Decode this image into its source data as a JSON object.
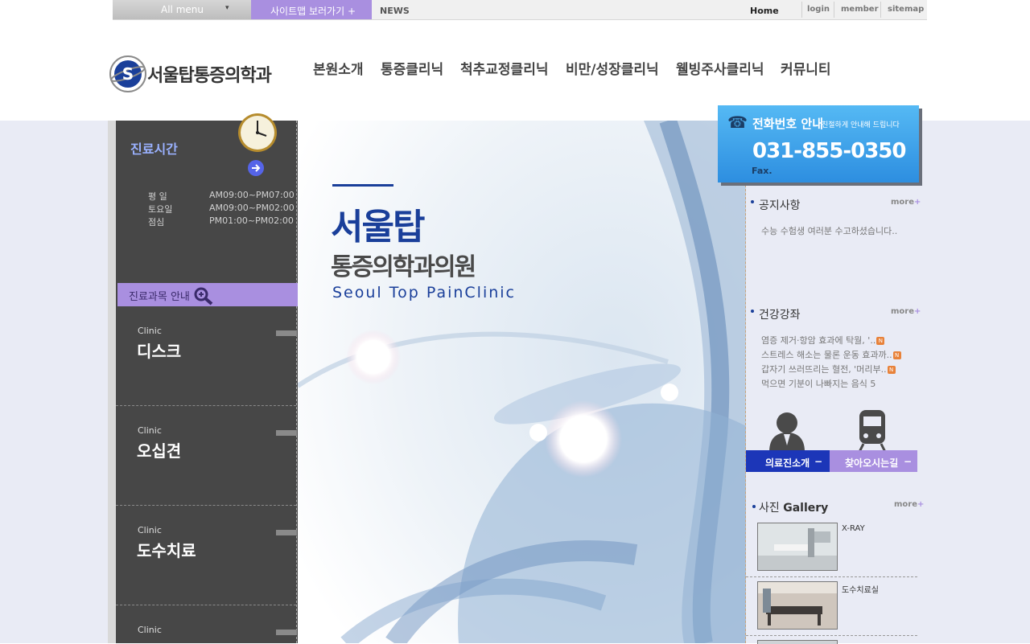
{
  "topbar": {
    "all_menu": "All menu",
    "sitemap": "사이트맵 보러가기 +",
    "news": "NEWS",
    "home": "Home",
    "login": "login",
    "member": "member",
    "sitemap_link": "sitemap"
  },
  "logo": {
    "text": "서울탑통증의학과",
    "emblem_letter": "S"
  },
  "nav": [
    "본원소개",
    "통증클리닉",
    "척추교정클리닉",
    "비만/성장클리닉",
    "웰빙주사클리닉",
    "커뮤니티"
  ],
  "hours": {
    "title": "진료시간",
    "rows": [
      {
        "day": "평 일",
        "time": "AM09:00~PM07:00"
      },
      {
        "day": "토요일",
        "time": "AM09:00~PM02:00"
      },
      {
        "day": "점심",
        "time": "PM01:00~PM02:00"
      }
    ]
  },
  "clinic_guide": {
    "title": "진료과목 안내",
    "items": [
      {
        "en": "Clinic",
        "ko": "디스크"
      },
      {
        "en": "Clinic",
        "ko": "오십견"
      },
      {
        "en": "Clinic",
        "ko": "도수치료"
      },
      {
        "en": "Clinic",
        "ko": ""
      }
    ]
  },
  "hero": {
    "title_big": "서울탑",
    "title_sub": "통증의학과의원",
    "english": "Seoul Top PainClinic"
  },
  "phone": {
    "title": "전화번호 안내",
    "subtitle": "친절하게 안내해 드립니다",
    "number": "031-855-0350",
    "fax": "Fax."
  },
  "notice": {
    "title": "공지사항",
    "more": "more",
    "items": [
      "수능 수험생 여러분 수고하셨습니다.."
    ]
  },
  "health": {
    "title": "건강강좌",
    "more": "more",
    "items": [
      {
        "text": "염증 제거·항암 효과에 탁월, '..",
        "new": "N"
      },
      {
        "text": "스트레스 해소는 물론 운동 효과까..",
        "new": "N"
      },
      {
        "text": "갑자기 쓰러뜨리는 혈전, '머리부..",
        "new": "N"
      },
      {
        "text": "먹으면 기분이 나빠지는 음식 5",
        "new": ""
      }
    ]
  },
  "quick": {
    "staff": "의료진소개",
    "directions": "찾아오시는길"
  },
  "gallery": {
    "title_ko": "사진",
    "title_en": "Gallery",
    "more": "more",
    "items": [
      "X-RAY",
      "도수치료실"
    ]
  },
  "colors": {
    "purple": "#a98fe0",
    "dark_panel": "#474747",
    "navy": "#1a3f9a",
    "phone_blue": "#2d8ee0"
  }
}
